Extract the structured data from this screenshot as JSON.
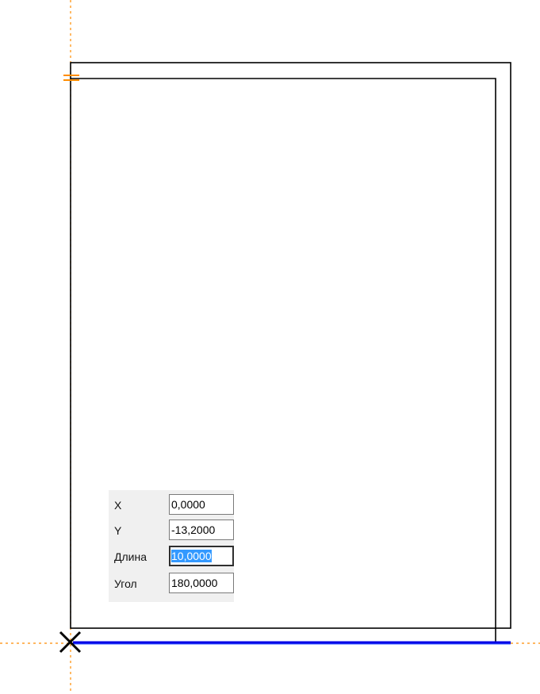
{
  "coordinate_panel": {
    "fields": [
      {
        "label": "X",
        "value": "0,0000"
      },
      {
        "label": "Y",
        "value": "-13,2000"
      },
      {
        "label": "Длина",
        "value": "10,0000"
      },
      {
        "label": "Угол",
        "value": "180,0000"
      }
    ],
    "active_field_index": 2
  },
  "colors": {
    "construction_line": "#ff8c00",
    "active_segment": "#0000e6",
    "selection_highlight": "#3399ff"
  },
  "icons": {
    "cursor": "crosshair-x-icon",
    "snap_marker": "parallel-snap-icon"
  }
}
